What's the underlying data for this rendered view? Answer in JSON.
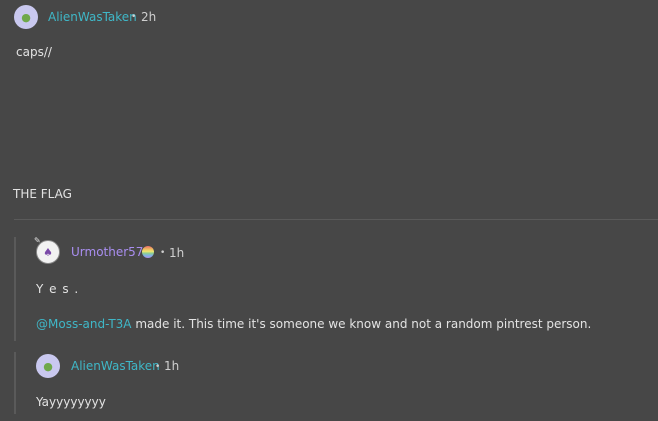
{
  "post": {
    "username": "AlienWasTaken",
    "time": "2h",
    "caption": "caps//",
    "content": "THE FLAG"
  },
  "replies": [
    {
      "username": "Urmother57",
      "time": "1h",
      "lines": [
        "Y e s ."
      ],
      "mention": "@Moss-and-T3A",
      "mention_rest": "made it. This time it's someone we know and not a random pintrest person."
    },
    {
      "username": "AlienWasTaken",
      "time": "1h",
      "text": "Yayyyyyyyy"
    }
  ],
  "dot": "•",
  "colors": {
    "background": "#474747",
    "username_teal": "#3fb7c7",
    "username_purple": "#a98ef0"
  }
}
